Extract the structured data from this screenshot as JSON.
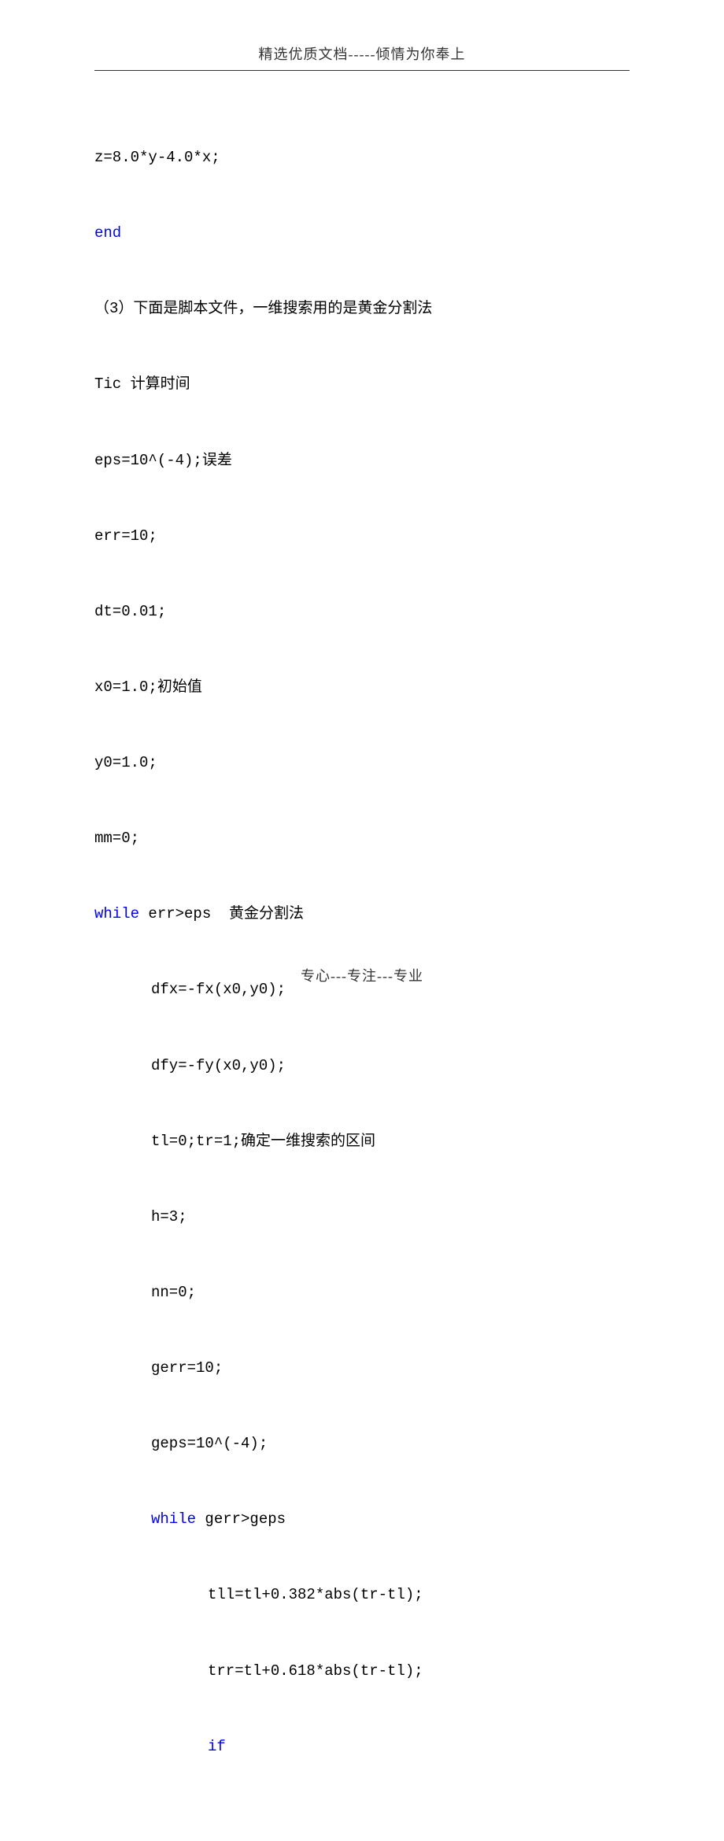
{
  "header": {
    "title": "精选优质文档-----倾情为你奉上"
  },
  "code": {
    "l1": "z=8.0*y-4.0*x;",
    "l2_kw": "end",
    "l3": "（3）下面是脚本文件，一维搜索用的是黄金分割法",
    "l4": "Tic 计算时间",
    "l5": "eps=10^(-4);误差",
    "l6": "err=10;",
    "l7": "dt=0.01;",
    "l8": "x0=1.0;初始值",
    "l9": "y0=1.0;",
    "l10": "mm=0;",
    "l11_kw": "while",
    "l11_rest": " err>eps  黄金分割法",
    "l12": "dfx=-fx(x0,y0);",
    "l13": "dfy=-fy(x0,y0);",
    "l14": "tl=0;tr=1;确定一维搜索的区间",
    "l15": "h=3;",
    "l16": "nn=0;",
    "l17": "gerr=10;",
    "l18": "geps=10^(-4);",
    "l19_kw": "while",
    "l19_rest": " gerr>geps",
    "l20": "tll=tl+0.382*abs(tr-tl);",
    "l21": "trr=tl+0.618*abs(tr-tl);",
    "l22_kw": "if"
  },
  "footer": {
    "text": "专心---专注---专业"
  }
}
